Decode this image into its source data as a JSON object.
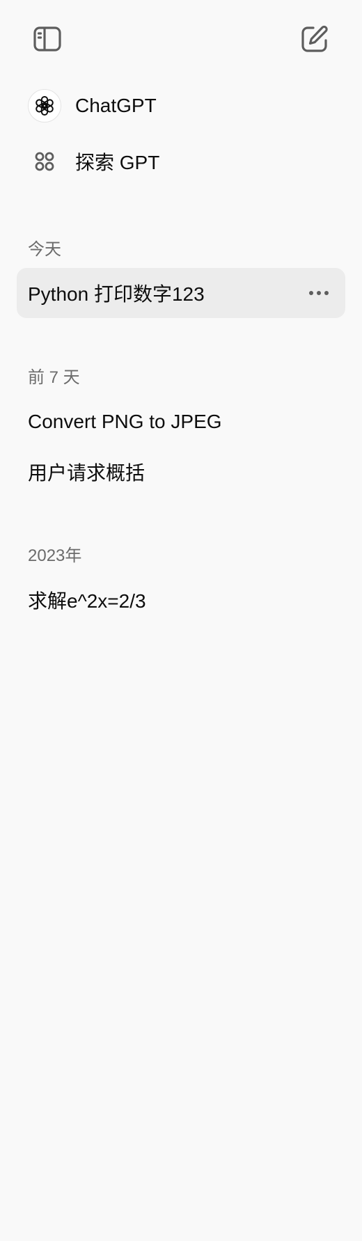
{
  "header": {
    "toggle_icon": "sidebar-toggle-icon",
    "new_chat_icon": "new-chat-icon"
  },
  "nav": {
    "items": [
      {
        "label": "ChatGPT",
        "icon": "openai-logo-icon"
      },
      {
        "label": "探索 GPT",
        "icon": "grid-dots-icon"
      }
    ]
  },
  "history": {
    "sections": [
      {
        "heading": "今天",
        "chats": [
          {
            "title": "Python 打印数字123",
            "active": true
          }
        ]
      },
      {
        "heading": "前 7 天",
        "chats": [
          {
            "title": "Convert PNG to JPEG",
            "active": false
          },
          {
            "title": "用户请求概括",
            "active": false
          }
        ]
      },
      {
        "heading": "2023年",
        "chats": [
          {
            "title": "求解e^2x=2/3",
            "active": false
          }
        ]
      }
    ]
  },
  "colors": {
    "background": "#f9f9f9",
    "active_item": "#ececec",
    "text_primary": "#0d0d0d",
    "text_secondary": "#6b6b6b",
    "icon": "#5d5d5d"
  }
}
